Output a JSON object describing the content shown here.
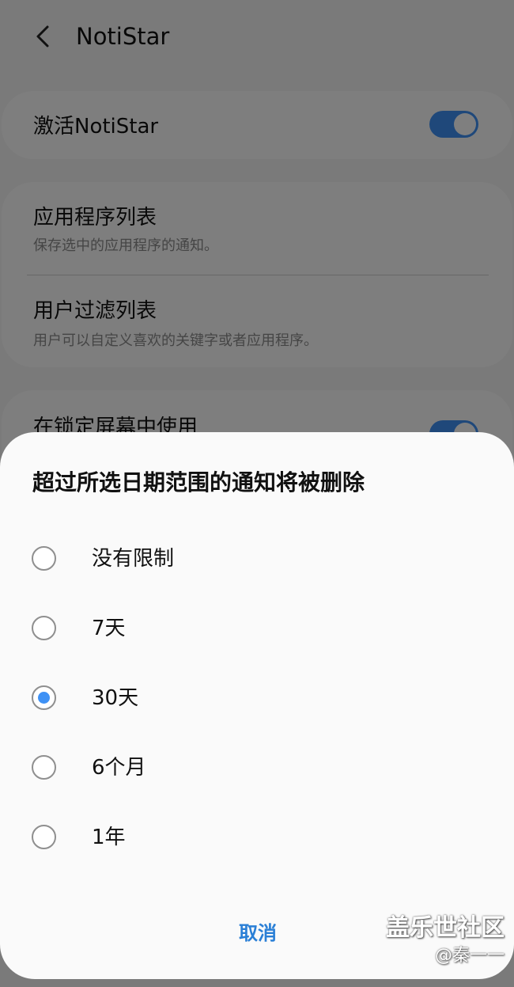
{
  "appbar": {
    "title": "NotiStar",
    "back_icon": "chevron-left-icon"
  },
  "settings": {
    "activate": {
      "label": "激活NotiStar",
      "toggle_on": true
    },
    "app_list": {
      "title": "应用程序列表",
      "subtitle": "保存选中的应用程序的通知。"
    },
    "user_filter": {
      "title": "用户过滤列表",
      "subtitle": "用户可以自定义喜欢的关键字或者应用程序。"
    },
    "lock_screen": {
      "label": "在锁定屏幕中使用",
      "toggle_on": true
    }
  },
  "dialog": {
    "title": "超过所选日期范围的通知将被删除",
    "options": [
      {
        "label": "没有限制",
        "selected": false
      },
      {
        "label": "7天",
        "selected": false
      },
      {
        "label": "30天",
        "selected": true
      },
      {
        "label": "6个月",
        "selected": false
      },
      {
        "label": "1年",
        "selected": false
      }
    ],
    "cancel_label": "取消"
  },
  "watermark": {
    "main": "盖乐世社区",
    "sub": "@秦一一"
  },
  "colors": {
    "accent": "#3e91f5",
    "cancel_text": "#2a7fd6",
    "overlay": "rgba(0,0,0,0.5)"
  }
}
